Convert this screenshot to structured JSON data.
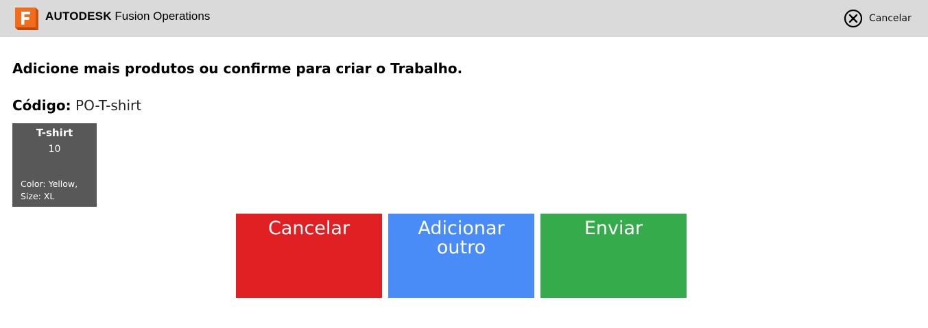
{
  "header": {
    "brand_bold": "AUTODESK",
    "brand_product": "Fusion Operations",
    "logo_icon": "autodesk-fusion-f-icon",
    "cancel_icon": "circle-x-icon",
    "cancel_label": "Cancelar"
  },
  "main": {
    "headline": "Adicione mais produtos ou confirme para criar o Trabalho.",
    "code_label": "Código:",
    "code_value": "PO-T-shirt"
  },
  "products": [
    {
      "name": "T-shirt",
      "quantity": "10",
      "attributes_line1": "Color: Yellow,",
      "attributes_line2": "Size: XL"
    }
  ],
  "actions": {
    "cancel": "Cancelar",
    "add_line1": "Adicionar",
    "add_line2": "outro",
    "send": "Enviar"
  },
  "colors": {
    "topbar": "#dadada",
    "cancel_button": "#e02022",
    "add_button": "#4a8cf7",
    "send_button": "#36ab4b",
    "product_card": "#585858",
    "logo_orange": "#f26c1c"
  }
}
